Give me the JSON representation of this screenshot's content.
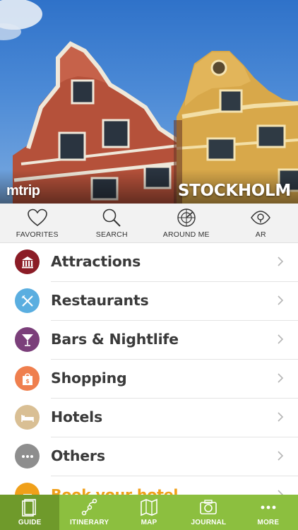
{
  "hero": {
    "brand": "mtrip",
    "city": "STOCKHOLM"
  },
  "quickbar": [
    {
      "label": "FAVORITES",
      "icon": "heart-icon"
    },
    {
      "label": "SEARCH",
      "icon": "search-icon"
    },
    {
      "label": "AROUND ME",
      "icon": "radar-icon"
    },
    {
      "label": "AR",
      "icon": "eye-icon"
    }
  ],
  "categories": [
    {
      "label": "Attractions",
      "icon": "museum-icon",
      "color": "#8b1c26"
    },
    {
      "label": "Restaurants",
      "icon": "fork-knife-icon",
      "color": "#5aaee0"
    },
    {
      "label": "Bars & Nightlife",
      "icon": "cocktail-icon",
      "color": "#7b3f7a"
    },
    {
      "label": "Shopping",
      "icon": "shopping-bag-icon",
      "color": "#ef7f4e"
    },
    {
      "label": "Hotels",
      "icon": "bed-icon",
      "color": "#d9bf94"
    },
    {
      "label": "Others",
      "icon": "more-dots-icon",
      "color": "#8e8e8e"
    },
    {
      "label": "Book your hotel",
      "icon": "hotel-booking-icon",
      "color": "#f0a01a"
    }
  ],
  "tabs": [
    {
      "label": "GUIDE",
      "icon": "guide-book-icon",
      "active": true
    },
    {
      "label": "ITINERARY",
      "icon": "itinerary-icon",
      "active": false
    },
    {
      "label": "MAP",
      "icon": "map-icon",
      "active": false
    },
    {
      "label": "JOURNAL",
      "icon": "camera-icon",
      "active": false
    },
    {
      "label": "MORE",
      "icon": "more-dots-icon",
      "active": false
    }
  ],
  "colors": {
    "tabbar": "#8cbf3f",
    "tab_active": "#6f9a2b",
    "promo": "#f0a01a"
  }
}
